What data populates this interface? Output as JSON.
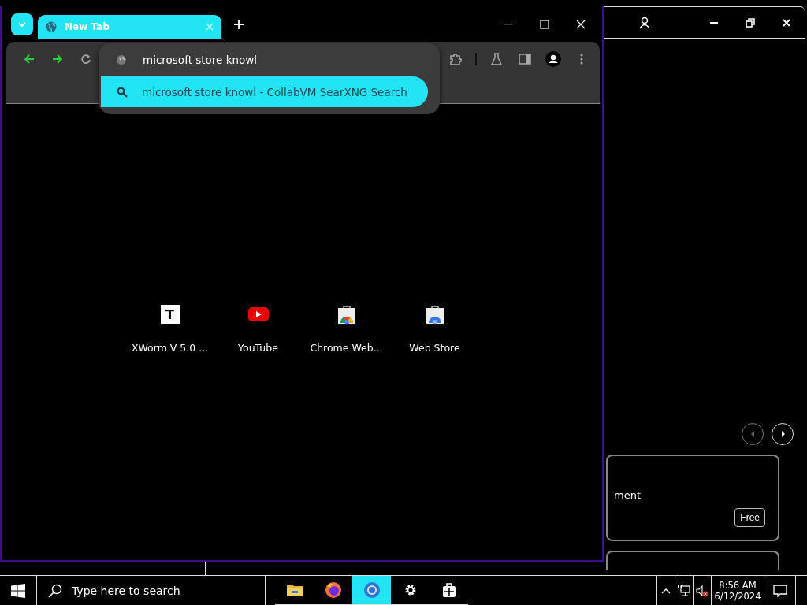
{
  "store_window": {
    "nav_buttons": [
      {
        "kind": "previous",
        "disabled": true
      },
      {
        "kind": "next",
        "disabled": false
      }
    ],
    "cards": [
      {
        "title": "ment",
        "price": "Free"
      }
    ]
  },
  "browser": {
    "tabs": [
      {
        "title": "New Tab",
        "selected": true
      }
    ],
    "omnibox": {
      "value": "microsoft store knowl"
    },
    "suggestions": [
      {
        "text": "microsoft store knowl - CollabVM SearXNG Search",
        "selected": true
      }
    ],
    "shortcuts": [
      {
        "title": "XWorm V 5.0 ...",
        "kind": "letter",
        "letter": "T"
      },
      {
        "title": "YouTube",
        "kind": "youtube"
      },
      {
        "title": "Chrome Web...",
        "kind": "webstore"
      },
      {
        "title": "Web Store",
        "kind": "webstore-blue"
      }
    ]
  },
  "taskbar": {
    "search": {
      "placeholder": "Type here to search"
    },
    "apps": [
      {
        "kind": "explorer",
        "selected": false,
        "running": true
      },
      {
        "kind": "firefox",
        "selected": false,
        "running": true
      },
      {
        "kind": "chrome",
        "selected": true,
        "running": true
      },
      {
        "kind": "settings",
        "selected": false,
        "running": true
      },
      {
        "kind": "store",
        "selected": false,
        "running": true
      }
    ],
    "clock": {
      "time": "8:56 AM",
      "date": "6/12/2024"
    }
  }
}
